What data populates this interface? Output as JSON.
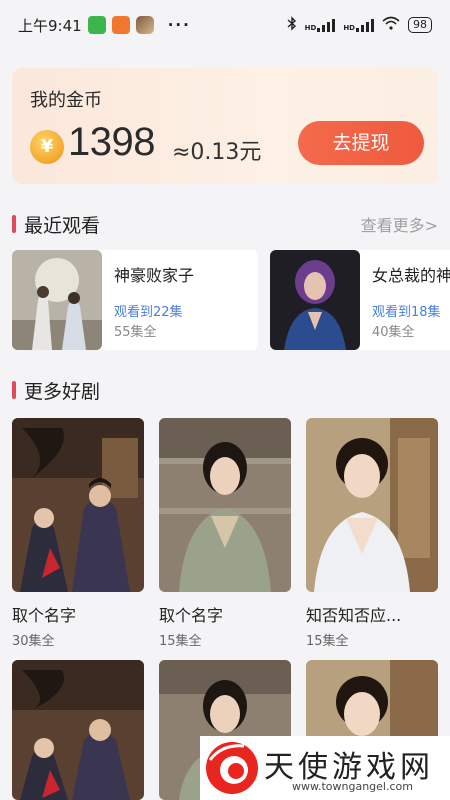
{
  "status_bar": {
    "time": "上午9:41",
    "dots": "···",
    "hd1": "HD",
    "hd2": "HD",
    "battery": "98"
  },
  "coins": {
    "title": "我的金币",
    "coin_symbol": "¥",
    "amount": "1398",
    "approx": "≈0.13元",
    "withdraw_label": "去提现"
  },
  "recent": {
    "title": "最近观看",
    "see_more": "查看更多>",
    "items": [
      {
        "name": "神豪败家子",
        "progress": "观看到22集",
        "total": "55集全",
        "poster_icon": "drama-poster-image"
      },
      {
        "name": "女总裁的神",
        "progress": "观看到18集",
        "total": "40集全",
        "poster_icon": "drama-poster-image"
      }
    ]
  },
  "more": {
    "title": "更多好剧",
    "items": [
      {
        "name": "取个名字",
        "eps": "30集全"
      },
      {
        "name": "取个名字",
        "eps": "15集全"
      },
      {
        "name": "知否知否应...",
        "eps": "15集全"
      },
      {
        "name": "",
        "eps": ""
      },
      {
        "name": "",
        "eps": ""
      },
      {
        "name": "",
        "eps": ""
      }
    ]
  },
  "watermark": {
    "text": "天使游戏网",
    "url": "www.towngangel.com"
  },
  "colors": {
    "accent": "#e24a5a",
    "button": "#ef5a3e",
    "progress": "#4a7fd8"
  }
}
